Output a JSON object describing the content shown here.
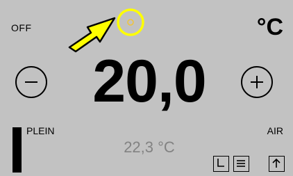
{
  "status": {
    "mode": "OFF",
    "unit": "°C"
  },
  "setpoint": {
    "value": "20,0",
    "decrease_icon": "minus-circle-icon",
    "increase_icon": "plus-circle-icon"
  },
  "level": {
    "label": "PLEIN",
    "fill": 1.0
  },
  "air": {
    "label": "AIR",
    "measured": "22,3 °C"
  },
  "buttons": {
    "schedule_icon": "schedule-icon",
    "menu_icon": "menu-icon",
    "up_icon": "arrow-up-icon"
  },
  "annotation": {
    "arrow_color": "#ffff00",
    "circle_color": "#ffff00",
    "target_color": "#f0c43a"
  },
  "colors": {
    "background": "#c2c2c2",
    "foreground": "#000000",
    "measured_text": "#828282"
  }
}
